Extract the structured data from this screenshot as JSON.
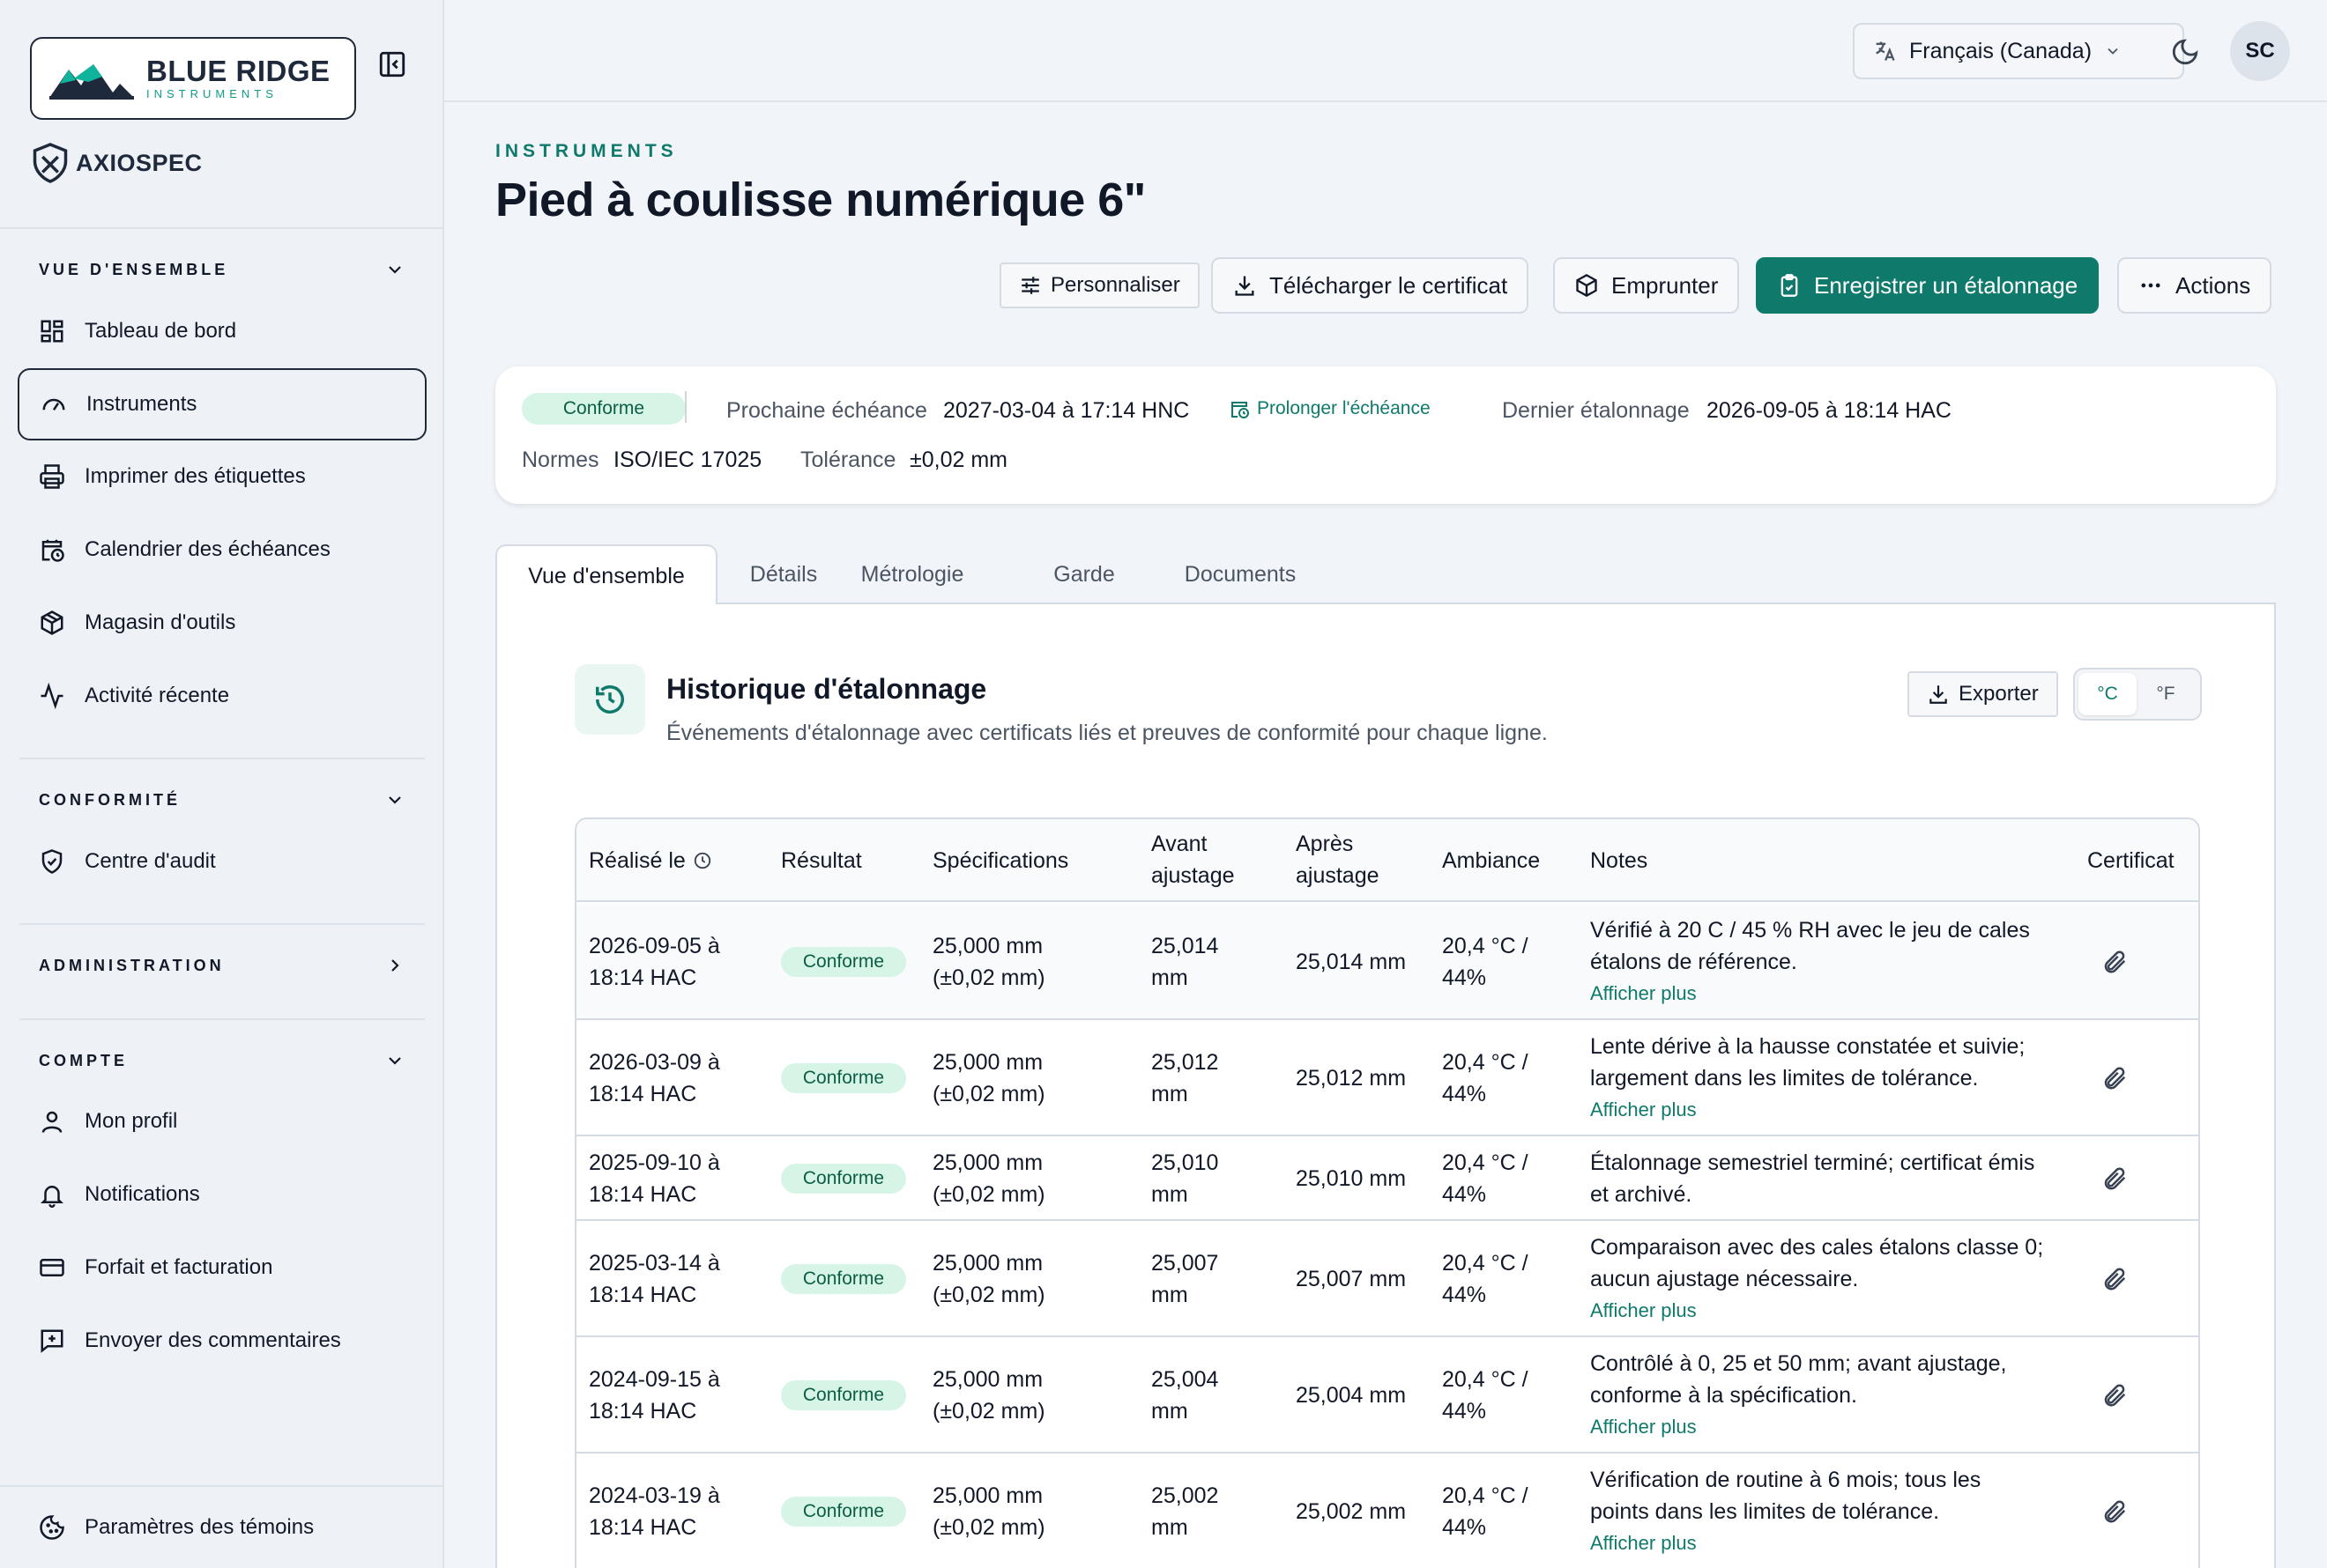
{
  "sidebar": {
    "brand": {
      "name": "BLUE RIDGE",
      "sub": "INSTRUMENTS"
    },
    "product": "AXIOSPEC",
    "sections": {
      "overview": "VUE D'ENSEMBLE",
      "compliance": "CONFORMITÉ",
      "admin": "ADMINISTRATION",
      "account": "COMPTE"
    },
    "items": {
      "dashboard": "Tableau de bord",
      "instruments": "Instruments",
      "labels": "Imprimer des étiquettes",
      "calendar": "Calendrier des échéances",
      "toolstore": "Magasin d'outils",
      "activity": "Activité récente",
      "audit": "Centre d'audit",
      "profile": "Mon profil",
      "notifications": "Notifications",
      "billing": "Forfait et facturation",
      "feedback": "Envoyer des commentaires",
      "cookies": "Paramètres des témoins"
    }
  },
  "topbar": {
    "language": "Français (Canada)",
    "avatar": "SC"
  },
  "page": {
    "eyebrow": "INSTRUMENTS",
    "title": "Pied à coulisse numérique 6\""
  },
  "actions": {
    "customize": "Personnaliser",
    "download": "Télécharger le certificat",
    "borrow": "Emprunter",
    "record": "Enregistrer un étalonnage",
    "more": "Actions"
  },
  "status": {
    "badge": "Conforme",
    "next_label": "Prochaine échéance",
    "next_value": "2027-03-04 à 17:14 HNC",
    "extend": "Prolonger l'échéance",
    "last_label": "Dernier étalonnage",
    "last_value": "2026-09-05 à 18:14 HAC",
    "norms_label": "Normes",
    "norms_value": "ISO/IEC 17025",
    "tolerance_label": "Tolérance",
    "tolerance_value": "±0,02 mm"
  },
  "tabs": [
    "Vue d'ensemble",
    "Détails",
    "Métrologie",
    "Garde",
    "Documents"
  ],
  "history": {
    "title": "Historique d'étalonnage",
    "subtitle": "Événements d'étalonnage avec certificats liés et preuves de conformité pour chaque ligne.",
    "export": "Exporter",
    "units": [
      "°C",
      "°F"
    ],
    "more_label": "Afficher plus",
    "columns": {
      "date": "Réalisé le",
      "result": "Résultat",
      "spec": "Spécifications",
      "before_1": "Avant",
      "before_2": "ajustage",
      "after_1": "Après",
      "after_2": "ajustage",
      "ambient": "Ambiance",
      "notes": "Notes",
      "cert": "Certificat"
    },
    "rows": [
      {
        "date_1": "2026-09-05 à",
        "date_2": "18:14 HAC",
        "result": "Conforme",
        "spec_1": "25,000 mm",
        "spec_2": "(±0,02 mm)",
        "before_1": "25,014",
        "before_2": "mm",
        "after": "25,014 mm",
        "amb_1": "20,4 °C /",
        "amb_2": "44%",
        "notes_1": "Vérifié à 20 C / 45 % RH avec le jeu de cales",
        "notes_2": "étalons de référence.",
        "more": "Afficher plus"
      },
      {
        "date_1": "2026-03-09 à",
        "date_2": "18:14 HAC",
        "result": "Conforme",
        "spec_1": "25,000 mm",
        "spec_2": "(±0,02 mm)",
        "before_1": "25,012",
        "before_2": "mm",
        "after": "25,012 mm",
        "amb_1": "20,4 °C /",
        "amb_2": "44%",
        "notes_1": "Lente dérive à la hausse constatée et suivie;",
        "notes_2": "largement dans les limites de tolérance.",
        "more": "Afficher plus"
      },
      {
        "date_1": "2025-09-10 à",
        "date_2": "18:14 HAC",
        "result": "Conforme",
        "spec_1": "25,000 mm",
        "spec_2": "(±0,02 mm)",
        "before_1": "25,010",
        "before_2": "mm",
        "after": "25,010 mm",
        "amb_1": "20,4 °C /",
        "amb_2": "44%",
        "notes_1": "Étalonnage semestriel terminé; certificat émis",
        "notes_2": "et archivé.",
        "more": ""
      },
      {
        "date_1": "2025-03-14 à",
        "date_2": "18:14 HAC",
        "result": "Conforme",
        "spec_1": "25,000 mm",
        "spec_2": "(±0,02 mm)",
        "before_1": "25,007",
        "before_2": "mm",
        "after": "25,007 mm",
        "amb_1": "20,4 °C /",
        "amb_2": "44%",
        "notes_1": "Comparaison avec des cales étalons classe 0;",
        "notes_2": "aucun ajustage nécessaire.",
        "more": "Afficher plus"
      },
      {
        "date_1": "2024-09-15 à",
        "date_2": "18:14 HAC",
        "result": "Conforme",
        "spec_1": "25,000 mm",
        "spec_2": "(±0,02 mm)",
        "before_1": "25,004",
        "before_2": "mm",
        "after": "25,004 mm",
        "amb_1": "20,4 °C /",
        "amb_2": "44%",
        "notes_1": "Contrôlé à 0, 25 et 50 mm; avant ajustage,",
        "notes_2": "conforme à la spécification.",
        "more": "Afficher plus"
      },
      {
        "date_1": "2024-03-19 à",
        "date_2": "18:14 HAC",
        "result": "Conforme",
        "spec_1": "25,000 mm",
        "spec_2": "(±0,02 mm)",
        "before_1": "25,002",
        "before_2": "mm",
        "after": "25,002 mm",
        "amb_1": "20,4 °C /",
        "amb_2": "44%",
        "notes_1": "Vérification de routine à 6 mois; tous les",
        "notes_2": "points dans les limites de tolérance.",
        "more": "Afficher plus"
      }
    ]
  },
  "colors": {
    "accent": "#0f7a6c",
    "badge_bg": "#d7f5e7",
    "badge_fg": "#0b5e45"
  },
  "icons": [
    "logo-mountains",
    "collapse-sidebar-icon",
    "axiospec-shield-icon",
    "dashboard-grid-icon",
    "gauge-icon",
    "printer-icon",
    "calendar-clock-icon",
    "package-icon",
    "activity-icon",
    "shield-check-icon",
    "user-icon",
    "bell-icon",
    "credit-card-icon",
    "message-plus-icon",
    "cookie-icon",
    "translate-icon",
    "chevron-down-icon",
    "moon-icon",
    "sliders-icon",
    "download-icon",
    "package-icon",
    "clipboard-check-icon",
    "ellipsis-icon",
    "history-icon",
    "paperclip-icon",
    "clock-icon"
  ]
}
